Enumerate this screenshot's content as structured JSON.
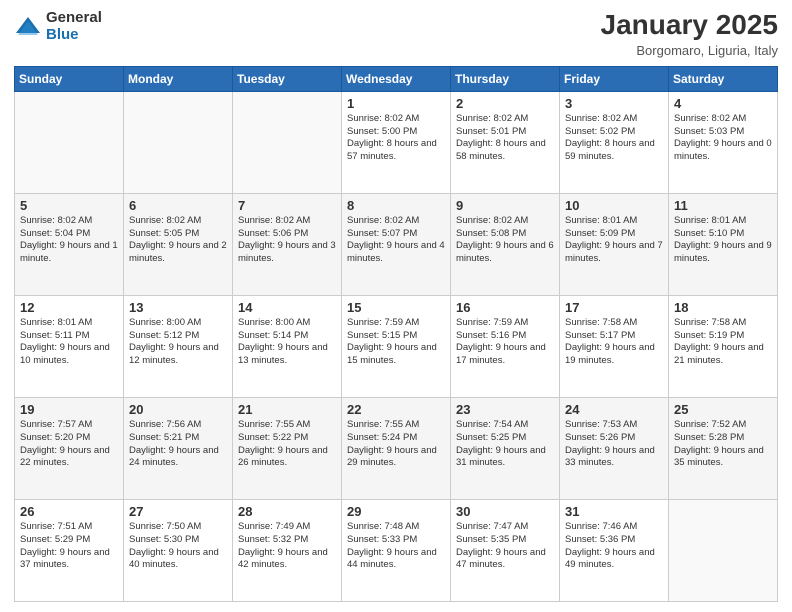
{
  "logo": {
    "general": "General",
    "blue": "Blue"
  },
  "header": {
    "title": "January 2025",
    "subtitle": "Borgomaro, Liguria, Italy"
  },
  "weekdays": [
    "Sunday",
    "Monday",
    "Tuesday",
    "Wednesday",
    "Thursday",
    "Friday",
    "Saturday"
  ],
  "weeks": [
    [
      {
        "day": "",
        "content": ""
      },
      {
        "day": "",
        "content": ""
      },
      {
        "day": "",
        "content": ""
      },
      {
        "day": "1",
        "content": "Sunrise: 8:02 AM\nSunset: 5:00 PM\nDaylight: 8 hours\nand 57 minutes."
      },
      {
        "day": "2",
        "content": "Sunrise: 8:02 AM\nSunset: 5:01 PM\nDaylight: 8 hours\nand 58 minutes."
      },
      {
        "day": "3",
        "content": "Sunrise: 8:02 AM\nSunset: 5:02 PM\nDaylight: 8 hours\nand 59 minutes."
      },
      {
        "day": "4",
        "content": "Sunrise: 8:02 AM\nSunset: 5:03 PM\nDaylight: 9 hours\nand 0 minutes."
      }
    ],
    [
      {
        "day": "5",
        "content": "Sunrise: 8:02 AM\nSunset: 5:04 PM\nDaylight: 9 hours\nand 1 minute."
      },
      {
        "day": "6",
        "content": "Sunrise: 8:02 AM\nSunset: 5:05 PM\nDaylight: 9 hours\nand 2 minutes."
      },
      {
        "day": "7",
        "content": "Sunrise: 8:02 AM\nSunset: 5:06 PM\nDaylight: 9 hours\nand 3 minutes."
      },
      {
        "day": "8",
        "content": "Sunrise: 8:02 AM\nSunset: 5:07 PM\nDaylight: 9 hours\nand 4 minutes."
      },
      {
        "day": "9",
        "content": "Sunrise: 8:02 AM\nSunset: 5:08 PM\nDaylight: 9 hours\nand 6 minutes."
      },
      {
        "day": "10",
        "content": "Sunrise: 8:01 AM\nSunset: 5:09 PM\nDaylight: 9 hours\nand 7 minutes."
      },
      {
        "day": "11",
        "content": "Sunrise: 8:01 AM\nSunset: 5:10 PM\nDaylight: 9 hours\nand 9 minutes."
      }
    ],
    [
      {
        "day": "12",
        "content": "Sunrise: 8:01 AM\nSunset: 5:11 PM\nDaylight: 9 hours\nand 10 minutes."
      },
      {
        "day": "13",
        "content": "Sunrise: 8:00 AM\nSunset: 5:12 PM\nDaylight: 9 hours\nand 12 minutes."
      },
      {
        "day": "14",
        "content": "Sunrise: 8:00 AM\nSunset: 5:14 PM\nDaylight: 9 hours\nand 13 minutes."
      },
      {
        "day": "15",
        "content": "Sunrise: 7:59 AM\nSunset: 5:15 PM\nDaylight: 9 hours\nand 15 minutes."
      },
      {
        "day": "16",
        "content": "Sunrise: 7:59 AM\nSunset: 5:16 PM\nDaylight: 9 hours\nand 17 minutes."
      },
      {
        "day": "17",
        "content": "Sunrise: 7:58 AM\nSunset: 5:17 PM\nDaylight: 9 hours\nand 19 minutes."
      },
      {
        "day": "18",
        "content": "Sunrise: 7:58 AM\nSunset: 5:19 PM\nDaylight: 9 hours\nand 21 minutes."
      }
    ],
    [
      {
        "day": "19",
        "content": "Sunrise: 7:57 AM\nSunset: 5:20 PM\nDaylight: 9 hours\nand 22 minutes."
      },
      {
        "day": "20",
        "content": "Sunrise: 7:56 AM\nSunset: 5:21 PM\nDaylight: 9 hours\nand 24 minutes."
      },
      {
        "day": "21",
        "content": "Sunrise: 7:55 AM\nSunset: 5:22 PM\nDaylight: 9 hours\nand 26 minutes."
      },
      {
        "day": "22",
        "content": "Sunrise: 7:55 AM\nSunset: 5:24 PM\nDaylight: 9 hours\nand 29 minutes."
      },
      {
        "day": "23",
        "content": "Sunrise: 7:54 AM\nSunset: 5:25 PM\nDaylight: 9 hours\nand 31 minutes."
      },
      {
        "day": "24",
        "content": "Sunrise: 7:53 AM\nSunset: 5:26 PM\nDaylight: 9 hours\nand 33 minutes."
      },
      {
        "day": "25",
        "content": "Sunrise: 7:52 AM\nSunset: 5:28 PM\nDaylight: 9 hours\nand 35 minutes."
      }
    ],
    [
      {
        "day": "26",
        "content": "Sunrise: 7:51 AM\nSunset: 5:29 PM\nDaylight: 9 hours\nand 37 minutes."
      },
      {
        "day": "27",
        "content": "Sunrise: 7:50 AM\nSunset: 5:30 PM\nDaylight: 9 hours\nand 40 minutes."
      },
      {
        "day": "28",
        "content": "Sunrise: 7:49 AM\nSunset: 5:32 PM\nDaylight: 9 hours\nand 42 minutes."
      },
      {
        "day": "29",
        "content": "Sunrise: 7:48 AM\nSunset: 5:33 PM\nDaylight: 9 hours\nand 44 minutes."
      },
      {
        "day": "30",
        "content": "Sunrise: 7:47 AM\nSunset: 5:35 PM\nDaylight: 9 hours\nand 47 minutes."
      },
      {
        "day": "31",
        "content": "Sunrise: 7:46 AM\nSunset: 5:36 PM\nDaylight: 9 hours\nand 49 minutes."
      },
      {
        "day": "",
        "content": ""
      }
    ]
  ]
}
